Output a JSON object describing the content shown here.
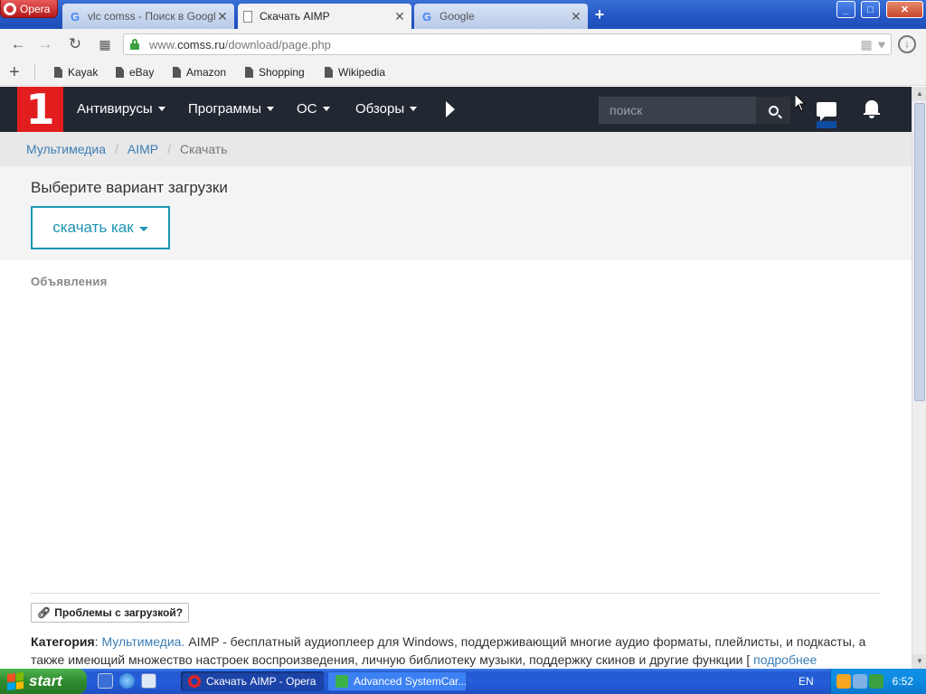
{
  "browser": {
    "menu_label": "Opera",
    "tabs": [
      {
        "title": "vlc comss - Поиск в Google",
        "favicon": "google-icon",
        "active": false
      },
      {
        "title": "Скачать AIMP",
        "favicon": "page-icon",
        "active": true
      },
      {
        "title": "Google",
        "favicon": "google-icon",
        "active": false
      }
    ],
    "new_tab": "+",
    "window_controls": {
      "minimize": "_",
      "maximize": "□",
      "close": "✕"
    },
    "url": {
      "prefix": "www.",
      "host": "comss.ru",
      "path": "/download/page.php"
    },
    "bookmarks": [
      "Kayak",
      "eBay",
      "Amazon",
      "Shopping",
      "Wikipedia"
    ]
  },
  "site": {
    "logo_text": "1",
    "menu": [
      "Антивирусы",
      "Программы",
      "ОС",
      "Обзоры"
    ],
    "search_placeholder": "поиск",
    "accent_color": "#1d95b3",
    "logo_color": "#e21d1d",
    "header_color": "#222831"
  },
  "breadcrumb": [
    "Мультимедиа",
    "AIMP",
    "Скачать"
  ],
  "download": {
    "heading": "Выберите вариант загрузки",
    "button_label": "скачать как"
  },
  "ads_label": "Объявления",
  "problems_label": "Проблемы с загрузкой?",
  "category": {
    "label": "Категория",
    "link": "Мультимедиа.",
    "text": " AIMP - бесплатный аудиоплеер для Windows, поддерживающий многие аудио форматы, плейлисты, и подкасты, а также имеющий множество настроек воспроизведения, личную библиотеку музыки, поддержку скинов и другие функции [ ",
    "more_link": "подробнее"
  },
  "taskbar": {
    "start_label": "start",
    "tasks": [
      {
        "title": "Скачать AIMP - Opera",
        "active": true
      },
      {
        "title": "Advanced SystemCar...",
        "active": false
      }
    ],
    "language": "EN",
    "clock": "6:52"
  }
}
